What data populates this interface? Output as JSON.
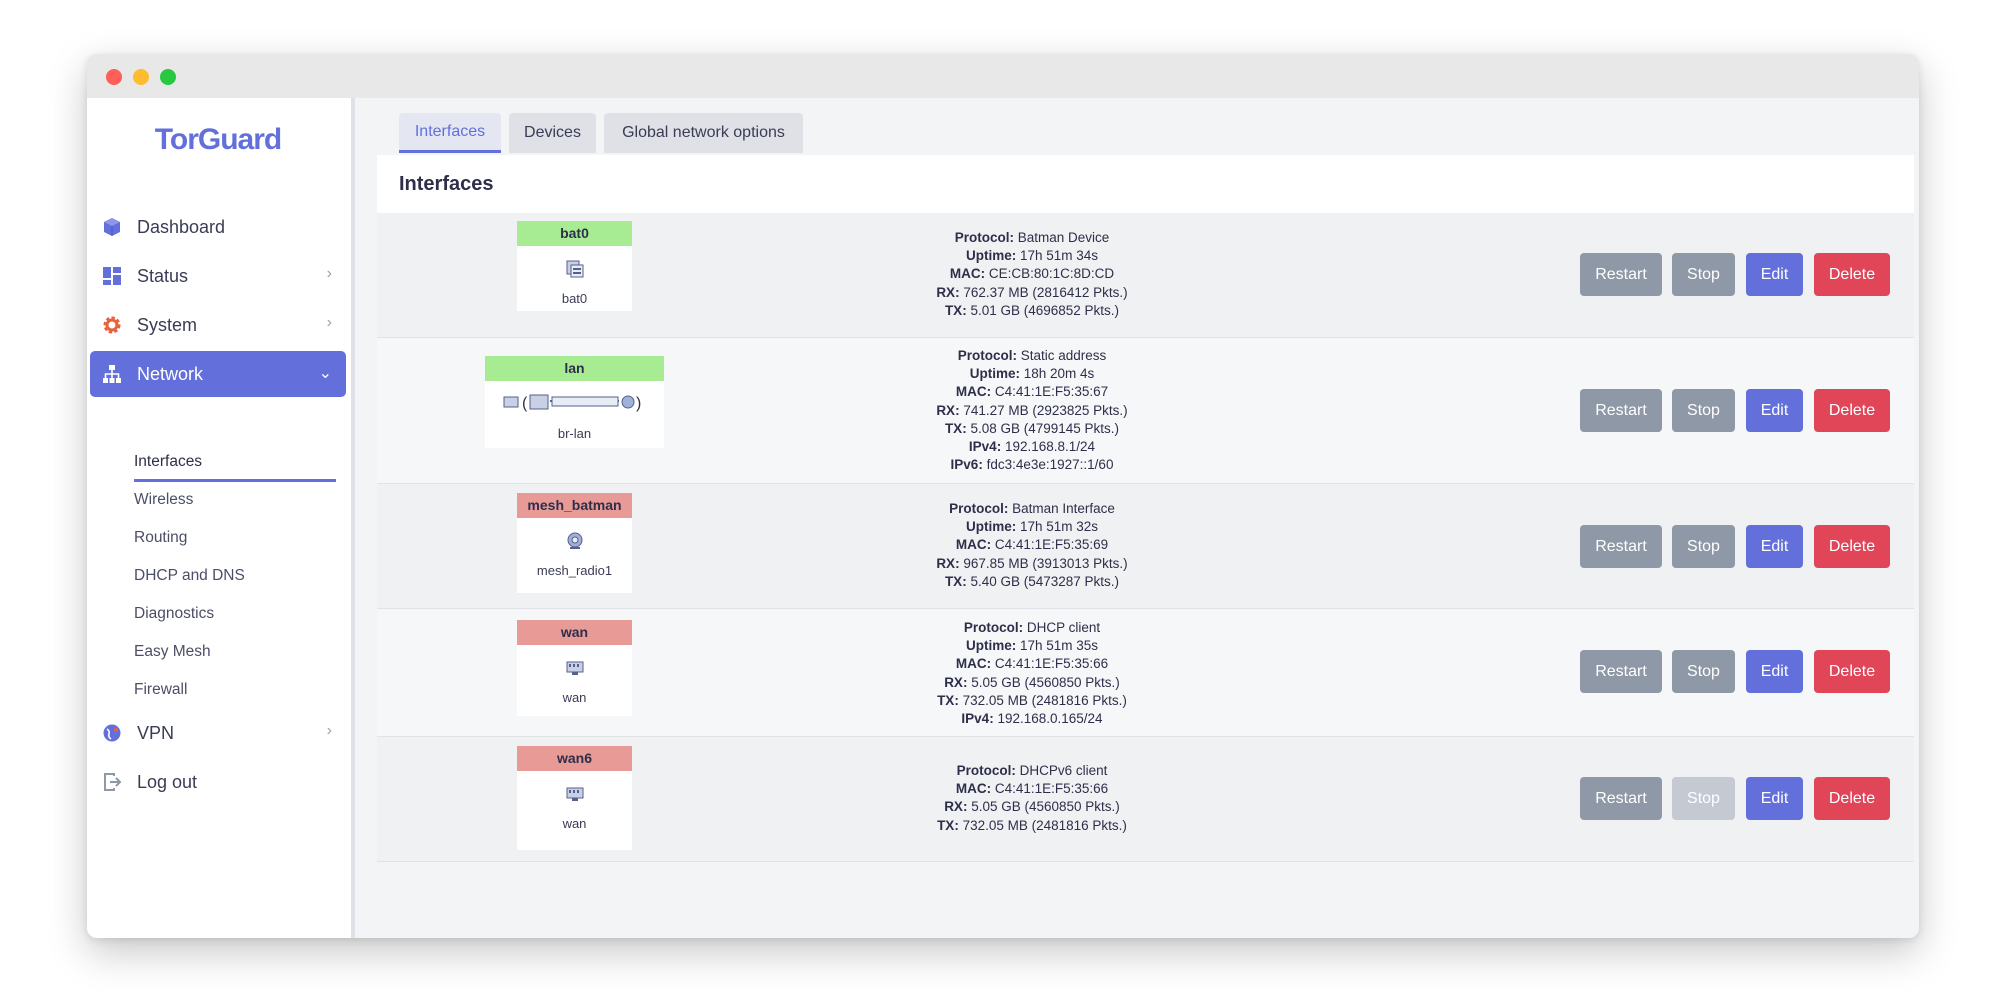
{
  "sidebar": {
    "logo": "TorGuard",
    "nav": [
      {
        "label": "Dashboard",
        "icon": "cube-icon",
        "color": "#6370dc"
      },
      {
        "label": "Status",
        "icon": "grid-icon",
        "color": "#6370dc"
      },
      {
        "label": "System",
        "icon": "gear-icon",
        "color": "#e8623a"
      },
      {
        "label": "Network",
        "icon": "network-tree-icon",
        "color": "#ffffff"
      },
      {
        "label": "VPN",
        "icon": "globe-icon",
        "color": "#6370dc"
      },
      {
        "label": "Log out",
        "icon": "logout-icon",
        "color": "#8e98a6"
      }
    ],
    "network_sub": [
      "Interfaces",
      "Wireless",
      "Routing",
      "DHCP and DNS",
      "Diagnostics",
      "Easy Mesh",
      "Firewall"
    ]
  },
  "tabs": [
    "Interfaces",
    "Devices",
    "Global network options"
  ],
  "panel_title": "Interfaces",
  "buttons": {
    "restart": "Restart",
    "stop": "Stop",
    "edit": "Edit",
    "delete": "Delete"
  },
  "interfaces": [
    {
      "name": "bat0",
      "device": "bat0",
      "status": "up",
      "lines": [
        [
          "Protocol:",
          "Batman Device"
        ],
        [
          "Uptime:",
          "17h 51m 34s"
        ],
        [
          "MAC:",
          "CE:CB:80:1C:8D:CD"
        ],
        [
          "RX:",
          "762.37 MB (2816412 Pkts.)"
        ],
        [
          "TX:",
          "5.01 GB (4696852 Pkts.)"
        ]
      ]
    },
    {
      "name": "lan",
      "device": "br-lan",
      "status": "up",
      "lines": [
        [
          "Protocol:",
          "Static address"
        ],
        [
          "Uptime:",
          "18h 20m 4s"
        ],
        [
          "MAC:",
          "C4:41:1E:F5:35:67"
        ],
        [
          "RX:",
          "741.27 MB (2923825 Pkts.)"
        ],
        [
          "TX:",
          "5.08 GB (4799145 Pkts.)"
        ],
        [
          "IPv4:",
          "192.168.8.1/24"
        ],
        [
          "IPv6:",
          "fdc3:4e3e:1927::1/60"
        ]
      ]
    },
    {
      "name": "mesh_batman",
      "device": "mesh_radio1",
      "status": "down",
      "lines": [
        [
          "Protocol:",
          "Batman Interface"
        ],
        [
          "Uptime:",
          "17h 51m 32s"
        ],
        [
          "MAC:",
          "C4:41:1E:F5:35:69"
        ],
        [
          "RX:",
          "967.85 MB (3913013 Pkts.)"
        ],
        [
          "TX:",
          "5.40 GB (5473287 Pkts.)"
        ]
      ]
    },
    {
      "name": "wan",
      "device": "wan",
      "status": "down",
      "lines": [
        [
          "Protocol:",
          "DHCP client"
        ],
        [
          "Uptime:",
          "17h 51m 35s"
        ],
        [
          "MAC:",
          "C4:41:1E:F5:35:66"
        ],
        [
          "RX:",
          "5.05 GB (4560850 Pkts.)"
        ],
        [
          "TX:",
          "732.05 MB (2481816 Pkts.)"
        ],
        [
          "IPv4:",
          "192.168.0.165/24"
        ]
      ]
    },
    {
      "name": "wan6",
      "device": "wan",
      "status": "down",
      "lines": [
        [
          "Protocol:",
          "DHCPv6 client"
        ],
        [
          "MAC:",
          "C4:41:1E:F5:35:66"
        ],
        [
          "RX:",
          "5.05 GB (4560850 Pkts.)"
        ],
        [
          "TX:",
          "732.05 MB (2481816 Pkts.)"
        ]
      ]
    }
  ]
}
